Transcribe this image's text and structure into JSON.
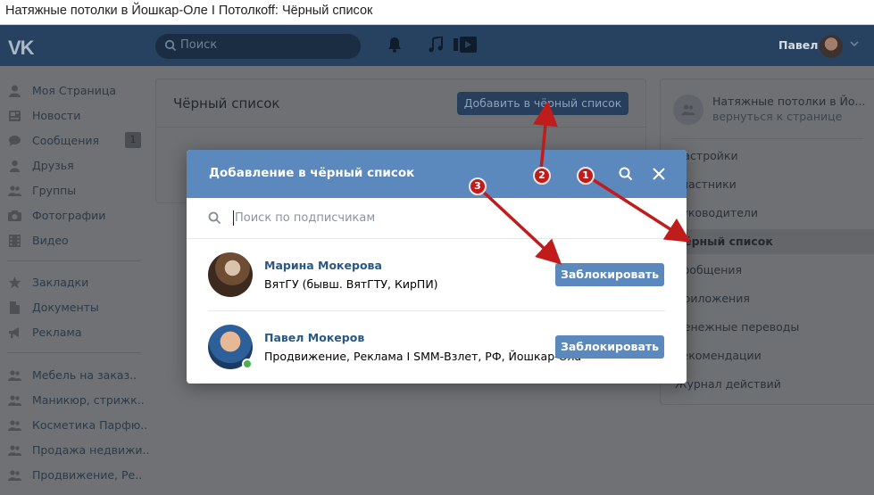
{
  "window": {
    "title": "Натяжные потолки в Йошкар-Оле I Потолкoff: Чёрный список"
  },
  "header": {
    "logo": "VK",
    "search_placeholder": "Поиск",
    "icons": [
      "bell-icon",
      "music-icon",
      "video-icon"
    ],
    "username": "Павел"
  },
  "sidebar": {
    "items": [
      {
        "label": "Моя Страница",
        "icon": "user-icon"
      },
      {
        "label": "Новости",
        "icon": "news-icon"
      },
      {
        "label": "Сообщения",
        "icon": "chat-icon",
        "count": "1"
      },
      {
        "label": "Друзья",
        "icon": "friend-icon"
      },
      {
        "label": "Группы",
        "icon": "groups-icon"
      },
      {
        "label": "Фотографии",
        "icon": "camera-icon"
      },
      {
        "label": "Видео",
        "icon": "film-icon"
      },
      {
        "label": "Закладки",
        "icon": "star-icon"
      },
      {
        "label": "Документы",
        "icon": "document-icon"
      },
      {
        "label": "Реклама",
        "icon": "megaphone-icon"
      },
      {
        "label": "Мебель на заказ..",
        "icon": "groups-icon"
      },
      {
        "label": "Маникюр, стрижк..",
        "icon": "groups-icon"
      },
      {
        "label": "Косметика Парфю..",
        "icon": "groups-icon"
      },
      {
        "label": "Продажа недвижи..",
        "icon": "groups-icon"
      },
      {
        "label": "Продвижение, Ре..",
        "icon": "groups-icon"
      }
    ]
  },
  "main": {
    "title": "Чёрный список",
    "add_button": "Добавить в чёрный список"
  },
  "right_panel": {
    "group_name": "Натяжные потолки в Йо...",
    "back_link": "вернуться к странице",
    "menu": [
      "Настройки",
      "Участники",
      "Руководители",
      "Чёрный список",
      "Сообщения",
      "Приложения",
      "Денежные переводы",
      "Рекомендации",
      "Журнал действий"
    ],
    "active_index": 3
  },
  "modal": {
    "title": "Добавление в чёрный список",
    "search_placeholder": "Поиск по подписчикам",
    "people": [
      {
        "name": "Марина Мокерова",
        "description": "ВятГУ (бывш. ВятГТУ, КирПИ)",
        "button": "Заблокировать",
        "online": false
      },
      {
        "name": "Павел Мокеров",
        "description": "Продвижение, Реклама I SMM-Взлет, РФ, Йошкар-Ола",
        "button": "Заблокировать",
        "online": true
      }
    ]
  },
  "annotations": {
    "badges": [
      "1",
      "2",
      "3"
    ],
    "color": "#c11c1c"
  },
  "colors": {
    "header": "#274160",
    "modal_header": "#5b88bd",
    "button": "#5b88bd",
    "link": "#2a5885",
    "overlay": "#6f7174"
  }
}
